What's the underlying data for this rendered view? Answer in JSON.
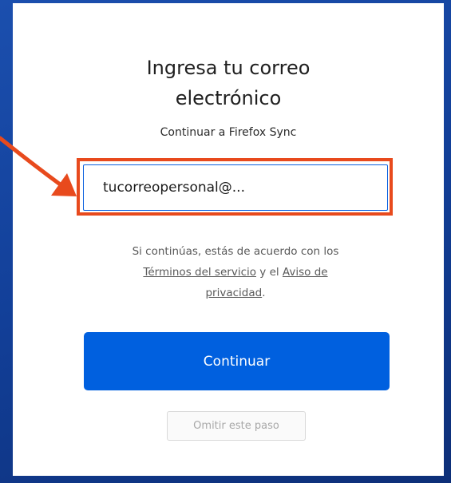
{
  "form": {
    "title_line1": "Ingresa tu correo",
    "title_line2": "electrónico",
    "subtitle": "Continuar a Firefox Sync",
    "email_value": "tucorreopersonal@..."
  },
  "legal": {
    "text_before": "Si continúas, estás de acuerdo con los",
    "terms_link": "Términos del servicio",
    "connector": " y el ",
    "privacy_link_line1": "Aviso de",
    "privacy_link_line2": "privacidad",
    "period": "."
  },
  "actions": {
    "continue_label": "Continuar",
    "skip_label": "Omitir este paso"
  },
  "colors": {
    "primary_button": "#0060df",
    "highlight_border": "#e84a1d",
    "arrow": "#e84a1d",
    "background_frame": "#1b4fae"
  },
  "icons": {
    "pointer": "arrow-icon"
  }
}
